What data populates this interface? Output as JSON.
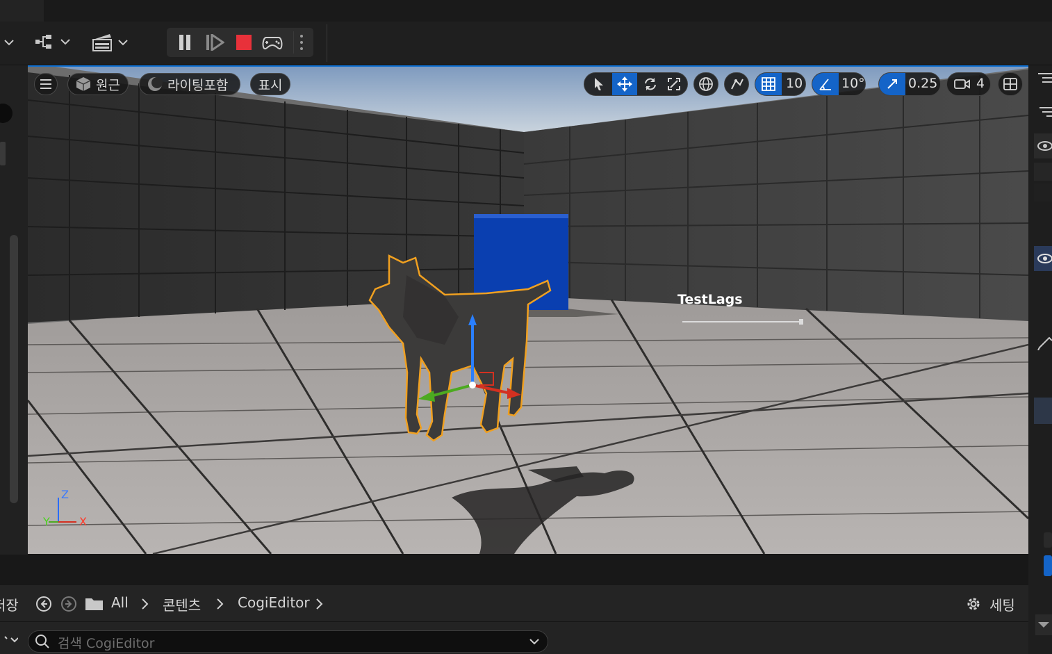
{
  "toolbar": {
    "icons": [
      "chevron-down-icon",
      "blueprint-icon",
      "chevron-down-icon",
      "cinematics-icon",
      "chevron-down-icon"
    ],
    "play": [
      "pause-icon",
      "step-icon",
      "stop-icon",
      "gamepad-icon",
      "more-icon"
    ]
  },
  "viewport": {
    "menu_icon": "hamburger-icon",
    "perspective_label": "원근",
    "lighting_label": "라이팅포함",
    "show_label": "표시",
    "grid_snap": "10",
    "angle_snap": "10°",
    "scale_snap": "0.25",
    "camera_speed": "4",
    "widget_text": "TestLags",
    "axis": {
      "z": "Z",
      "x": "X",
      "y": "Y"
    },
    "colors": {
      "sky": "#8ea6c4",
      "cube": "#0a3fb0",
      "selection": "#f0a020",
      "accent": "#1464c8"
    }
  },
  "content_browser": {
    "left_cut_label": "저장",
    "breadcrumb": [
      "All",
      "콘텐츠",
      "CogiEditor"
    ],
    "settings_label": "세팅",
    "search_placeholder": "검색 CogiEditor"
  }
}
